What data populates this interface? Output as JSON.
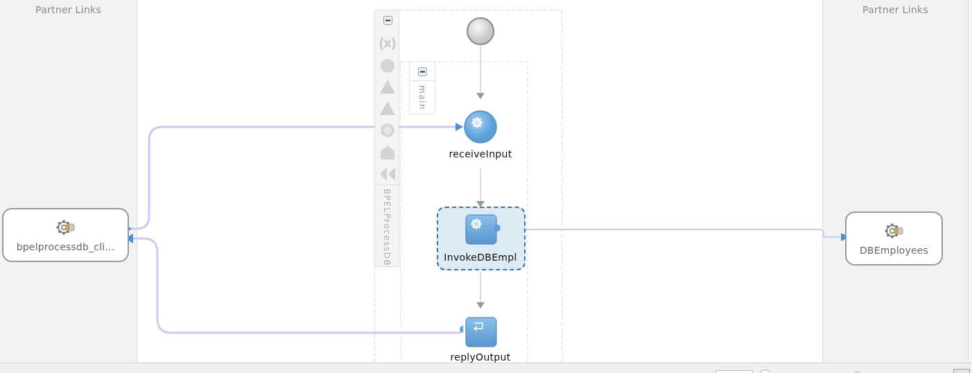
{
  "lanes": [
    {
      "title": "Partner Links"
    },
    {
      "title": "Partner Links"
    }
  ],
  "partner_links": [
    {
      "label": "bpelprocessdb_cli..."
    },
    {
      "label": "DBEmployees"
    }
  ],
  "process": {
    "name": "BPELProcessDB",
    "expanded": true,
    "scope": {
      "name": "main",
      "expanded": true
    },
    "activities": [
      {
        "kind": "start"
      },
      {
        "kind": "receive",
        "label": "receiveInput",
        "selected": false
      },
      {
        "kind": "invoke",
        "label": "InvokeDBEmpl",
        "selected": true
      },
      {
        "kind": "reply",
        "label": "replyOutput",
        "selected": false
      }
    ]
  }
}
